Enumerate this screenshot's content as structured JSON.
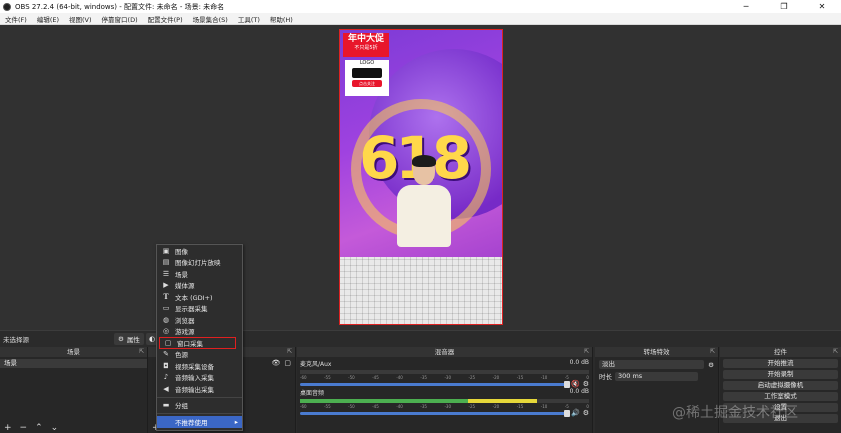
{
  "window": {
    "title": "OBS 27.2.4 (64-bit, windows) - 配置文件: 未命名 - 场景: 未命名",
    "minimize": "─",
    "maximize": "❐",
    "close": "✕"
  },
  "menubar": {
    "items": [
      "文件(F)",
      "编辑(E)",
      "视图(V)",
      "停靠窗口(D)",
      "配置文件(P)",
      "场景集合(S)",
      "工具(T)",
      "帮助(H)"
    ]
  },
  "preview": {
    "banner_line1": "年中大促",
    "banner_line2": "不只是5折",
    "logo_text": "LOGO",
    "logo_button": "点击关注",
    "big_text": "618"
  },
  "source_toolbar": {
    "no_source": "未选择源",
    "properties": "属性"
  },
  "scenes": {
    "title": "场景",
    "items": [
      "场景"
    ]
  },
  "context_menu": {
    "items": [
      "图像",
      "图像幻灯片放映",
      "场景",
      "媒体源",
      "文本 (GDI+)",
      "显示器采集",
      "浏览器",
      "游戏源",
      "窗口采集",
      "色源",
      "视频采集设备",
      "音频输入采集",
      "音频输出采集"
    ],
    "group": "分组",
    "deprecated": "不推荐使用",
    "highlighted_index": 8
  },
  "mixer": {
    "title": "混音器",
    "channels": [
      {
        "name": "麦克风/Aux",
        "db": "0.0 dB",
        "level": 0
      },
      {
        "name": "桌面音频",
        "db": "0.0 dB",
        "level": 0.82
      }
    ],
    "ticks": [
      "-60",
      "-55",
      "-50",
      "-45",
      "-40",
      "-35",
      "-30",
      "-25",
      "-20",
      "-15",
      "-10",
      "-5",
      "0"
    ]
  },
  "transitions": {
    "title": "转场特效",
    "selected": "淡出",
    "duration_label": "时长",
    "duration_value": "300 ms"
  },
  "controls": {
    "title": "控件",
    "buttons": [
      "开始推流",
      "开始录制",
      "启动虚拟摄像机",
      "工作室模式",
      "设置",
      "退出"
    ]
  },
  "watermark": "@稀土掘金技术社区"
}
